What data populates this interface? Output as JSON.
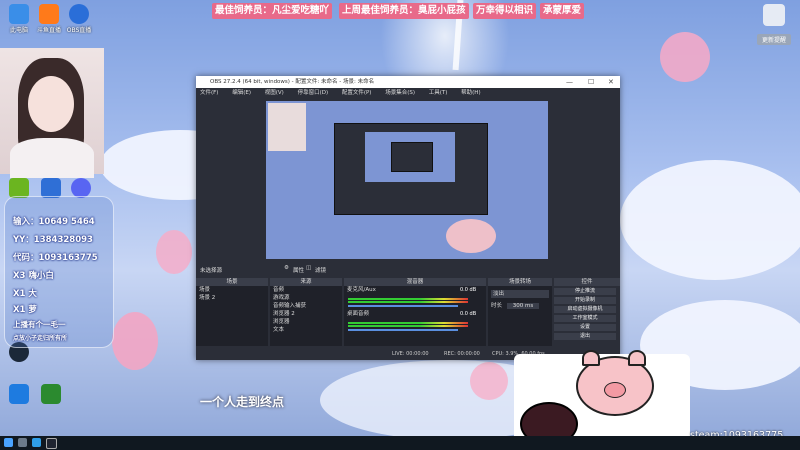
{
  "banners": {
    "b1": "最佳饲养员：凡尘爱吃糖吖",
    "b2": "上周最佳饲养员：臭屁小屁孩",
    "b3": "万幸得以相识",
    "b4": "承蒙厚爱"
  },
  "desktop_icons": [
    "此电脑",
    "斗鱼直播",
    "OBS直播",
    "NVIDIA",
    "雷神加速",
    "Discord",
    "Edge",
    "QQ",
    "YY",
    "Steam",
    "安全管家",
    "XBOX"
  ],
  "chat": {
    "l1": "输入：10649 5464",
    "l2": "YY：1384328093",
    "l3": "代码：1093163775",
    "l4": "X3  嗨小白",
    "l5": "X1  大",
    "l6": "X1  萝",
    "l7": "上播有个一毛一",
    "l8": "点放小子走归所有所"
  },
  "obs": {
    "title": "OBS 27.2.4 (64 bit, windows) - 配置文件: 未命名 - 场景: 未命名",
    "menu": [
      "文件(F)",
      "编辑(E)",
      "视图(V)",
      "停靠窗口(D)",
      "配置文件(P)",
      "场景集合(S)",
      "工具(T)",
      "帮助(H)"
    ],
    "no_source": "未选择源",
    "props_btn": "属性",
    "filter_btn": "滤镜",
    "docks": {
      "scenes": "场景",
      "sources": "来源",
      "mixer": "混音器",
      "transitions": "场景转场",
      "controls": "控件"
    },
    "scene_items": [
      "场景",
      "场景 2"
    ],
    "source_items": [
      "音频",
      "游戏源",
      "音频输入捕获",
      "浏览器 2",
      "浏览器",
      "文本"
    ],
    "mixer": {
      "ch1": "麦克风/Aux",
      "ch2": "桌面音频",
      "db1": "0.0 dB",
      "db2": "0.0 dB"
    },
    "transition": {
      "type": "淡出",
      "duration_label": "时长",
      "duration": "300 ms"
    },
    "controls": [
      "停止推流",
      "开始录制",
      "启动虚拟摄像机",
      "工作室模式",
      "设置",
      "退出"
    ],
    "status": {
      "live": "LIVE: 00:00:00",
      "rec": "REC: 00:00:00",
      "cpu": "CPU: 3.9%, 60.00 fps"
    }
  },
  "lyric": "一个人走到终点",
  "steam": "steam:1093163775",
  "brand_tag": "更新提醒"
}
